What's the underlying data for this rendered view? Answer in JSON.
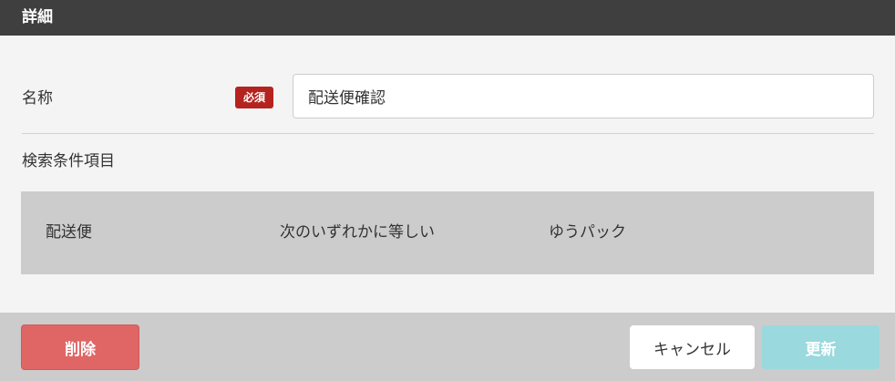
{
  "header": {
    "title": "詳細"
  },
  "form": {
    "name_label": "名称",
    "required_badge": "必須",
    "name_value": "配送便確認",
    "section_title": "検索条件項目",
    "conditions": [
      {
        "field": "配送便",
        "operator": "次のいずれかに等しい",
        "value": "ゆうパック"
      }
    ]
  },
  "footer": {
    "delete_label": "削除",
    "cancel_label": "キャンセル",
    "update_label": "更新"
  },
  "colors": {
    "header_bg": "#3f3f3f",
    "required_badge": "#b5231f",
    "delete_button": "#e06666",
    "update_button_disabled": "#9ad9dd"
  }
}
